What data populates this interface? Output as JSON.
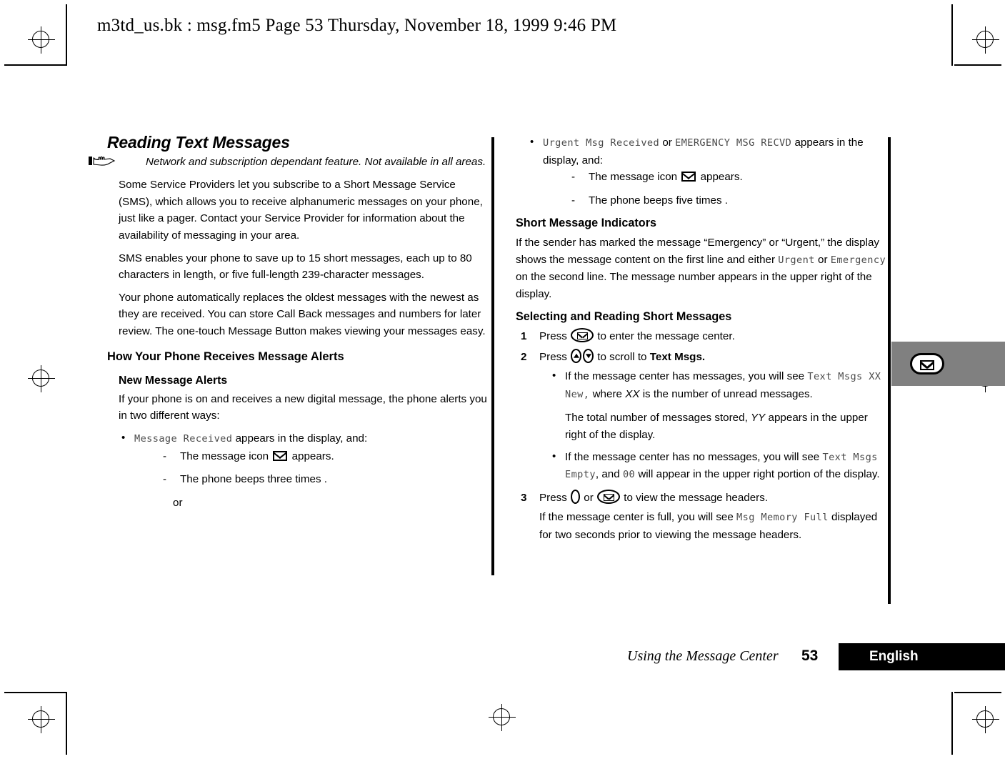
{
  "running_header": "m3td_us.bk : msg.fm5  Page 53  Thursday, November 18, 1999  9:46 PM",
  "left_column": {
    "title": "Reading Text Messages",
    "note": "Network and subscription dependant feature. Not available in all areas.",
    "para_sms_intro": "Some Service Providers let you subscribe to a Short Message Service (SMS), which allows you to receive alphanumeric messages on your phone, just like a pager. Contact your Service Provider for information about the availability of messaging in your area.",
    "para_sms_capacity": "SMS enables your phone to save up to 15 short messages, each up to 80 characters in length, or five full-length 239-character messages.",
    "para_sms_replace": "Your phone automatically replaces the oldest messages with the newest as they are received. You can store Call Back messages and numbers for later review. The one-touch Message Button makes viewing your messages easy.",
    "head_how_receives": "How Your Phone Receives Message Alerts",
    "head_new_alerts": "New Message Alerts",
    "para_new_alerts": "If your phone is on and receives a new digital message, the phone alerts you in two different ways:",
    "bullet_message_received_lcd": "Message Received",
    "bullet_message_received_tail": "appears in the display, and:",
    "dash_icon_pre": "The message icon",
    "dash_icon_post": "appears.",
    "dash_beeps": "The phone beeps three times .",
    "or_label": "or"
  },
  "right_column": {
    "bullet_urgent_lcd": "Urgent Msg Received",
    "bullet_or": "or",
    "bullet_emergency_lcd": "EMERGENCY MSG RECVD",
    "bullet_urgent_tail": "appears in the display, and:",
    "dash_icon_pre": "The message icon",
    "dash_icon_post": "appears.",
    "dash_beeps": "The phone beeps five times .",
    "head_short_indicators": "Short Message Indicators",
    "para_indicators_1": "If the sender has marked the message “Emergency” or “Urgent,” the display shows the message content on the first line and either",
    "para_indicators_lcd_urgent": "Urgent",
    "para_indicators_or": "or",
    "para_indicators_lcd_emergency": "Emergency",
    "para_indicators_2": "on the second line. The message number appears in the upper right of the display.",
    "head_selecting": "Selecting and Reading Short Messages",
    "step1_num": "1",
    "step1_pre": "Press",
    "step1_post": "to enter the message center.",
    "step2_num": "2",
    "step2_pre": "Press",
    "step2_mid": "to scroll to",
    "step2_bold": "Text Msgs.",
    "step2_b1_pre": "If the message center has messages, you will see",
    "step2_b1_lcd1": "Text Msgs XX New,",
    "step2_b1_mid": "where",
    "step2_b1_ital": "XX",
    "step2_b1_post": "is the number of unread messages.",
    "step2_sub_pre": "The total number of messages stored,",
    "step2_sub_ital": "YY",
    "step2_sub_post": "appears in the upper right of the display.",
    "step2_b2_pre": "If the message center has no messages, you will see",
    "step2_b2_lcd": "Text Msgs Empty",
    "step2_b2_mid": ", and",
    "step2_b2_lcd2": "00",
    "step2_b2_post": "will appear in the upper right portion of the display.",
    "step3_num": "3",
    "step3_pre": "Press",
    "step3_or": "or",
    "step3_post": "to view the message headers.",
    "step3_note_pre": "If the message center is full, you will see",
    "step3_note_lcd": "Msg Memory Full",
    "step3_note_post": "displayed for two seconds prior to viewing the message headers."
  },
  "thumb_tab": {
    "icon": "envelope-icon",
    "color": "#808080"
  },
  "footer": {
    "chapter": "Using the Message Center",
    "page_number": "53",
    "language": "English"
  }
}
